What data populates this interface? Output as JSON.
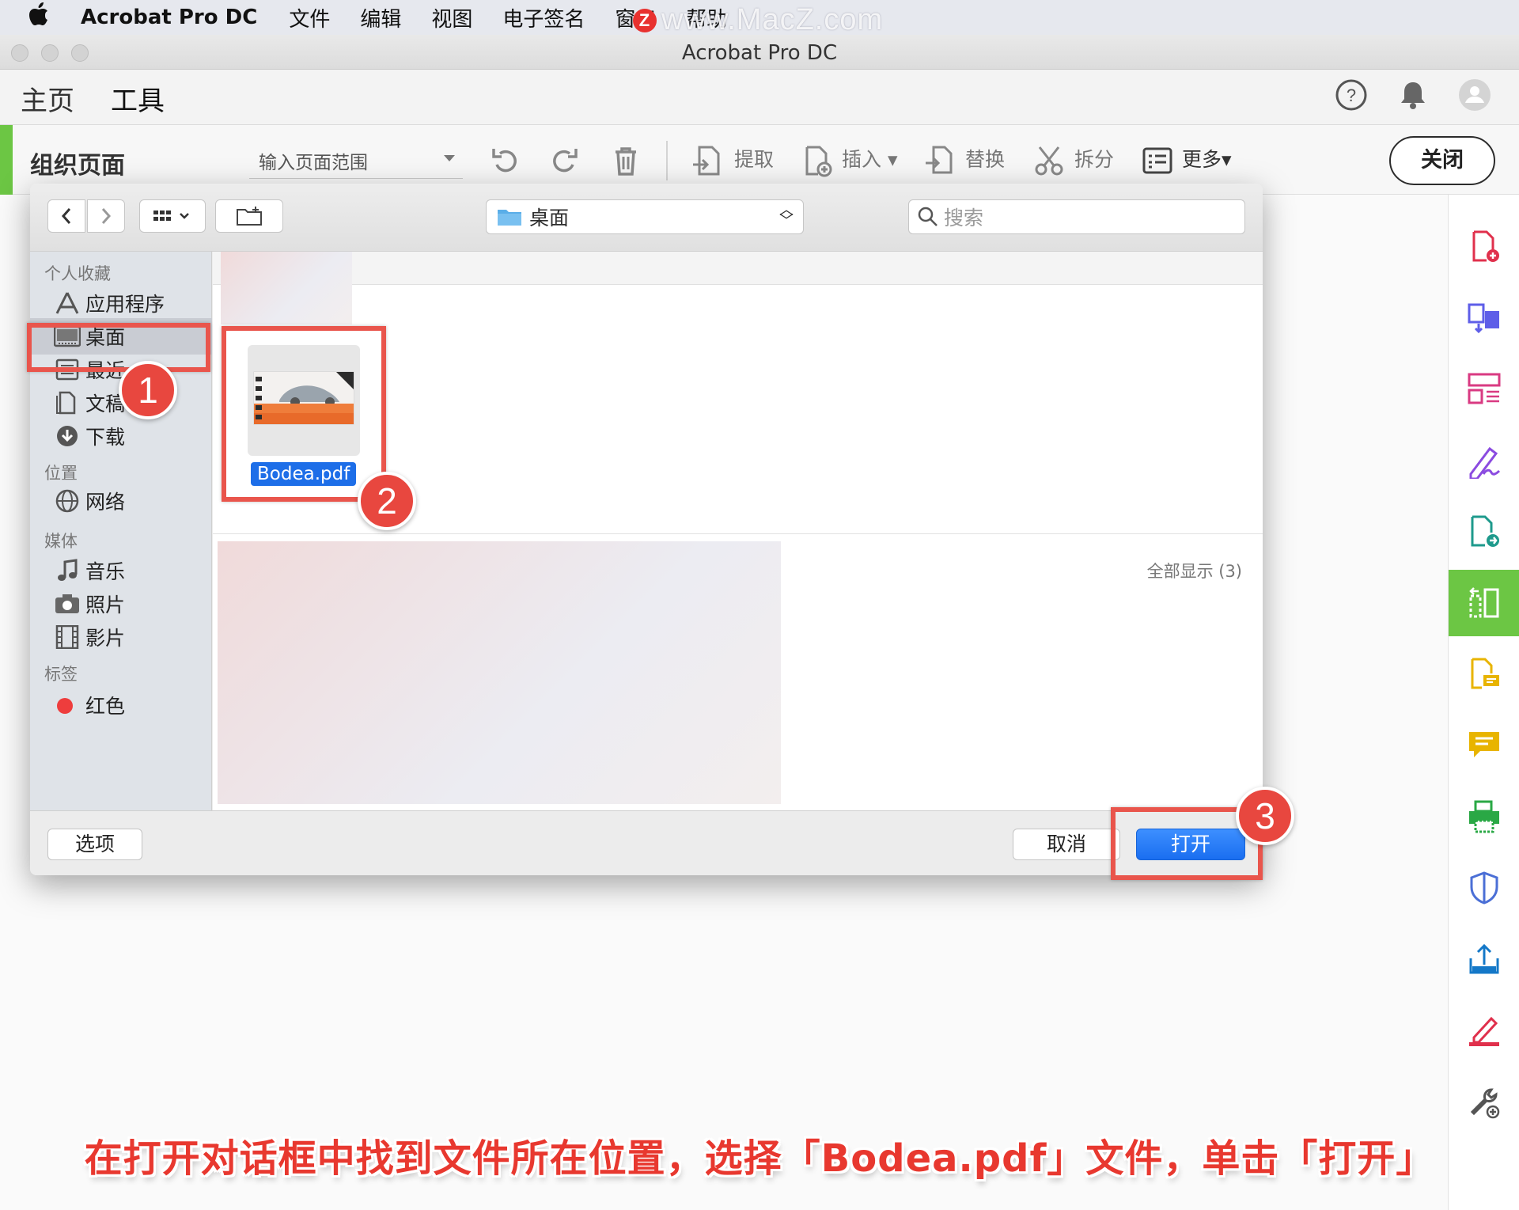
{
  "menubar": {
    "app_name": "Acrobat Pro DC",
    "items": [
      "文件",
      "编辑",
      "视图",
      "电子签名",
      "窗口",
      "帮助"
    ],
    "watermark": "www.MacZ.com"
  },
  "window": {
    "title": "Acrobat Pro DC"
  },
  "nav": {
    "home": "主页",
    "tools": "工具"
  },
  "toolbar": {
    "title": "组织页面",
    "range_placeholder": "输入页面范围",
    "extract": "提取",
    "insert": "插入",
    "replace": "替换",
    "split": "拆分",
    "more": "更多",
    "close": "关闭"
  },
  "dialog": {
    "location": "桌面",
    "search_placeholder": "搜索",
    "sidebar": {
      "favorites_header": "个人收藏",
      "favorites": [
        "应用程序",
        "桌面",
        "最近",
        "文稿",
        "下载"
      ],
      "locations_header": "位置",
      "locations": [
        "网络"
      ],
      "media_header": "媒体",
      "media": [
        "音乐",
        "照片",
        "影片"
      ],
      "tags_header": "标签",
      "tags": [
        "红色"
      ]
    },
    "file_name": "Bodea.pdf",
    "show_all": "全部显示 (3)",
    "options_btn": "选项",
    "cancel_btn": "取消",
    "open_btn": "打开"
  },
  "annotations": {
    "step1": "1",
    "step2": "2",
    "step3": "3"
  },
  "caption": "在打开对话框中找到文件所在位置，选择「Bodea.pdf」文件，单击「打开」",
  "colors": {
    "accent_green": "#6cc644",
    "annotation_red": "#e8473f",
    "open_blue": "#1a6ef0"
  }
}
